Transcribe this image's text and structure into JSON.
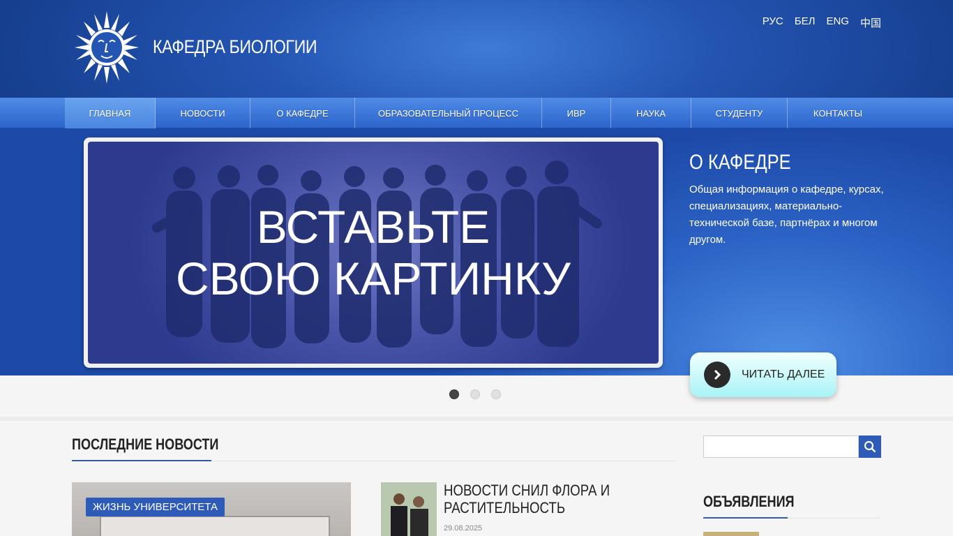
{
  "header": {
    "site_title": "КАФЕДРА БИОЛОГИИ",
    "languages": [
      "РУС",
      "БЕЛ",
      "ENG",
      "中国"
    ]
  },
  "nav": {
    "items": [
      "ГЛАВНАЯ",
      "НОВОСТИ",
      "О КАФЕДРЕ",
      "ОБРАЗОВАТЕЛЬНЫЙ ПРОЦЕСС",
      "ИВР",
      "НАУКА",
      "СТУДЕНТУ",
      "КОНТАКТЫ"
    ],
    "active": "ГЛАВНАЯ"
  },
  "slider": {
    "image_text_line1": "ВСТАВЬТЕ",
    "image_text_line2": "СВОЮ КАРТИНКУ",
    "title": "О КАФЕДРЕ",
    "text": "Общая информация о кафедре, курсах, специализациях, материально-технической базе, партнёрах и многом другом.",
    "read_more": "ЧИТАТЬ ДАЛЕЕ",
    "active_slide": 1,
    "slide_count": 3
  },
  "news": {
    "section_title": "ПОСЛЕДНИЕ НОВОСТИ",
    "featured_tag": "ЖИЗНЬ УНИВЕРСИТЕТА",
    "item_title": "НОВОСТИ СНИЛ ФЛОРА И РАСТИТЕЛЬНОСТЬ",
    "item_date": "29.08.2025"
  },
  "sidebar": {
    "search_placeholder": "",
    "announcements_title": "ОБЪЯВЛЕНИЯ"
  },
  "colors": {
    "brand_blue": "#2e5bb8",
    "header_dark": "#163f8f"
  }
}
